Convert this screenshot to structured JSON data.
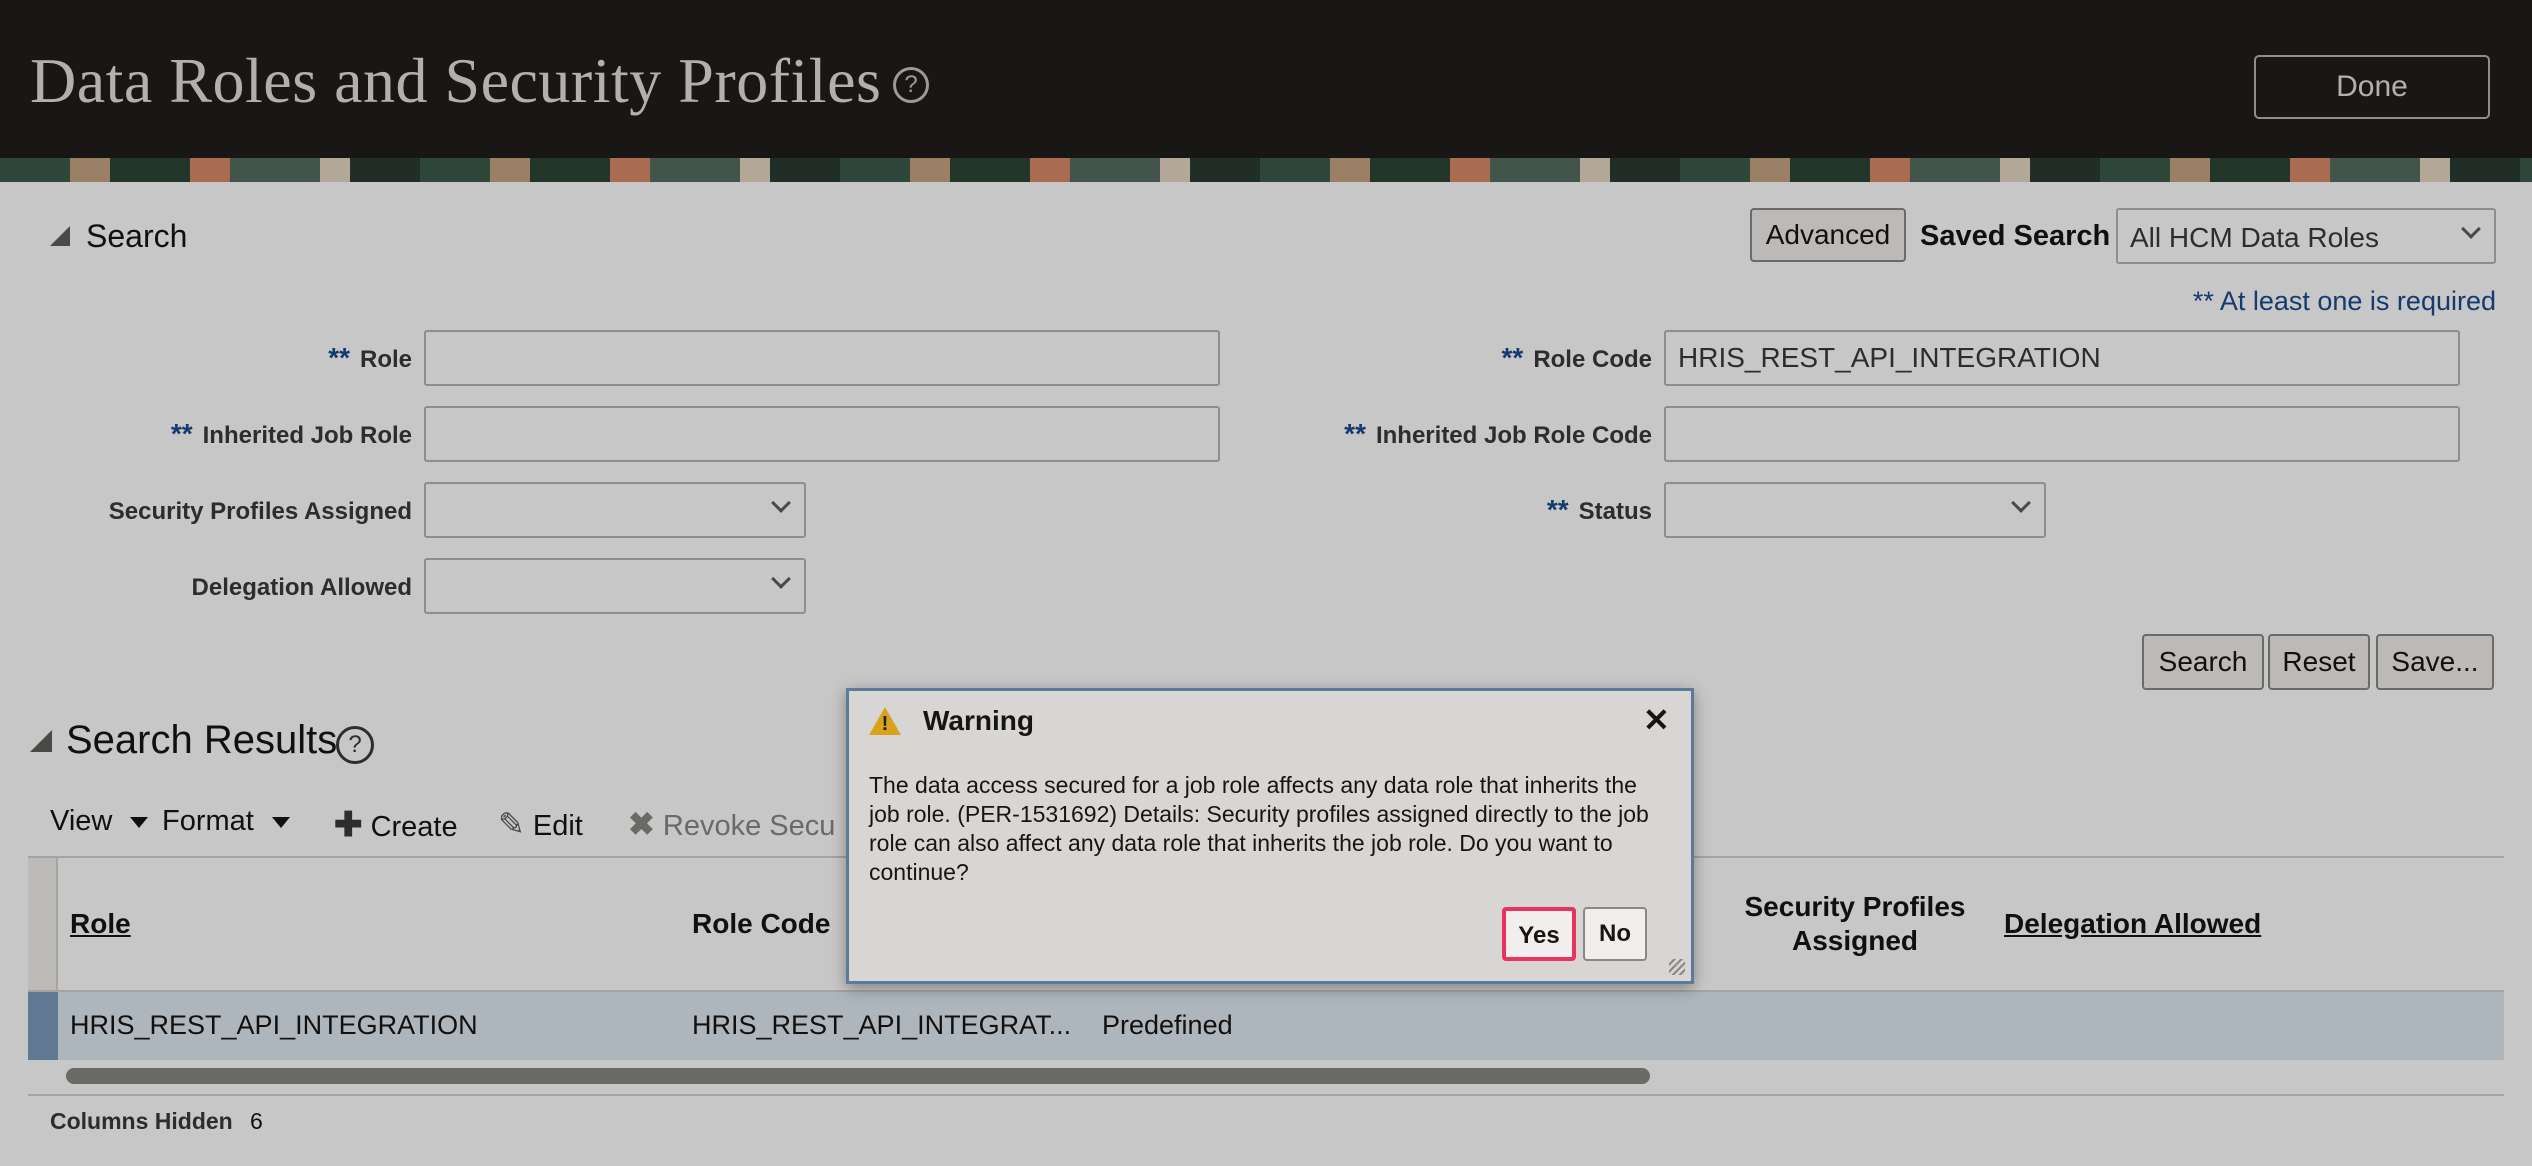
{
  "header": {
    "title": "Data Roles and Security Profiles",
    "help_glyph": "?",
    "done_label": "Done"
  },
  "search": {
    "section_label": "Search",
    "advanced_label": "Advanced",
    "saved_search_label": "Saved Search",
    "saved_search_value": "All HCM Data Roles",
    "required_note": "** At least one is required",
    "required_marker": "**",
    "fields": {
      "role_label": "Role",
      "role_value": "",
      "inherited_job_role_label": "Inherited Job Role",
      "inherited_job_role_value": "",
      "security_profiles_assigned_label": "Security Profiles Assigned",
      "delegation_allowed_label": "Delegation Allowed",
      "role_code_label": "Role Code",
      "role_code_value": "HRIS_REST_API_INTEGRATION",
      "inherited_job_role_code_label": "Inherited Job Role Code",
      "inherited_job_role_code_value": "",
      "status_label": "Status"
    },
    "buttons": {
      "search": "Search",
      "reset": "Reset",
      "save": "Save..."
    }
  },
  "results": {
    "section_label": "Search Results",
    "help_glyph": "?",
    "toolbar": {
      "view": "View",
      "format": "Format",
      "create": "Create",
      "edit": "Edit",
      "revoke": "Revoke Secu"
    },
    "columns": {
      "role": "Role",
      "role_code": "Role Code",
      "security_profiles_assigned_line1": "Security Profiles",
      "security_profiles_assigned_line2": "Assigned",
      "delegation_allowed": "Delegation Allowed"
    },
    "rows": [
      {
        "role": "HRIS_REST_API_INTEGRATION",
        "role_code": "HRIS_REST_API_INTEGRAT...",
        "type": "Predefined"
      }
    ],
    "columns_hidden_label": "Columns Hidden",
    "columns_hidden_count": "6"
  },
  "dialog": {
    "title": "Warning",
    "close_glyph": "✕",
    "message": "The data access secured for a job role affects any data role that inherits the job role. (PER-1531692) Details: Security profiles assigned directly to the job role can also affect any data role that inherits the job role. Do you want to continue?",
    "yes_label": "Yes",
    "no_label": "No",
    "yes_outline_color": "#e8325f"
  }
}
